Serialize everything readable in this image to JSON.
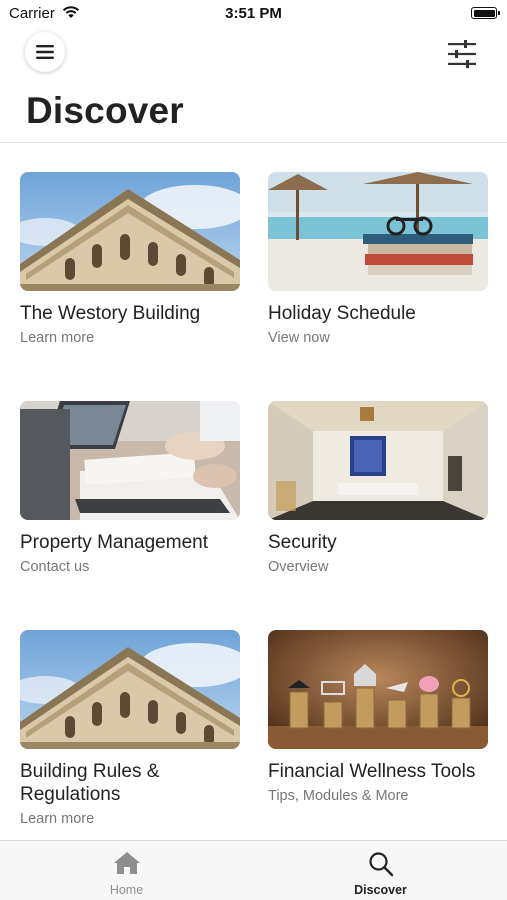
{
  "status_bar": {
    "carrier": "Carrier",
    "time": "3:51 PM"
  },
  "header": {
    "title": "Discover",
    "menu_icon": "hamburger-menu-icon",
    "filter_icon": "sliders-filter-icon"
  },
  "cards": [
    {
      "title": "The Westory Building",
      "subtitle": "Learn more",
      "image": "building-facade"
    },
    {
      "title": "Holiday Schedule",
      "subtitle": "View now",
      "image": "beach-books-sunglasses"
    },
    {
      "title": "Property Management",
      "subtitle": "Contact us",
      "image": "desk-laptop-documents"
    },
    {
      "title": "Security",
      "subtitle": "Overview",
      "image": "lobby-interior"
    },
    {
      "title": "Building Rules & Regulations",
      "subtitle": "Learn more",
      "image": "building-facade"
    },
    {
      "title": "Financial Wellness Tools",
      "subtitle": "Tips, Modules & More",
      "image": "coin-stacks"
    }
  ],
  "tabbar": {
    "items": [
      {
        "label": "Home",
        "icon": "home-icon",
        "active": false
      },
      {
        "label": "Discover",
        "icon": "search-icon",
        "active": true
      }
    ]
  },
  "colors": {
    "active_tab": "#222222",
    "inactive_tab": "#8e8e8e",
    "subtitle": "#777777"
  }
}
